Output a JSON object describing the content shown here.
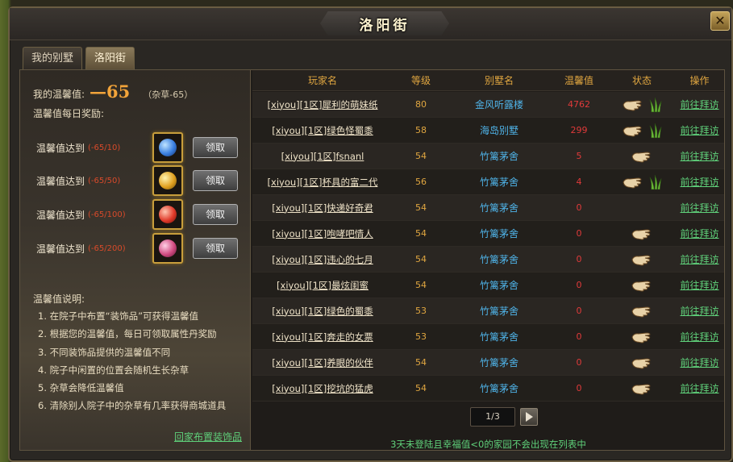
{
  "window": {
    "title": "洛阳街",
    "close_label": "✕"
  },
  "tabs": [
    {
      "label": "我的别墅",
      "active": false
    },
    {
      "label": "洛阳街",
      "active": true
    }
  ],
  "sidebar": {
    "my_warmth_label": "我的温馨值:",
    "my_warmth_value": "—65",
    "weeds_note": "（杂草-65）",
    "reward_heading": "温馨值每日奖励:",
    "rewards": [
      {
        "label": "温馨值达到",
        "condition": "(-65/10)",
        "button": "领取",
        "orb_color": "#3a7fe0"
      },
      {
        "label": "温馨值达到",
        "condition": "(-65/50)",
        "button": "领取",
        "orb_color": "#e0a020"
      },
      {
        "label": "温馨值达到",
        "condition": "(-65/100)",
        "button": "领取",
        "orb_color": "#e03a2a"
      },
      {
        "label": "温馨值达到",
        "condition": "(-65/200)",
        "button": "领取",
        "orb_color": "#d04a80"
      }
    ],
    "help_heading": "温馨值说明:",
    "help_items": [
      "1. 在院子中布置“装饰品”可获得温馨值",
      "2. 根据您的温馨值，每日可领取属性丹奖励",
      "3. 不同装饰品提供的温馨值不同",
      "4. 院子中闲置的位置会随机生长杂草",
      "5. 杂草会降低温馨值",
      "6. 清除别人院子中的杂草有几率获得商城道具"
    ],
    "decorate_link": "回家布置装饰品"
  },
  "table": {
    "headers": [
      "玩家名",
      "等级",
      "别墅名",
      "温馨值",
      "状态",
      "操作"
    ],
    "rows": [
      {
        "player": "[xiyou][1区]犀利的萌妹纸",
        "level": "80",
        "villa": "金风听露楼",
        "warmth": "4762",
        "hand": true,
        "grass": true,
        "action": "前往拜访"
      },
      {
        "player": "[xiyou][1区]绿色怪蜀黍",
        "level": "58",
        "villa": "海岛别墅",
        "warmth": "299",
        "hand": true,
        "grass": true,
        "action": "前往拜访"
      },
      {
        "player": "[xiyou][1区]fsnanl",
        "level": "54",
        "villa": "竹篱茅舍",
        "warmth": "5",
        "hand": true,
        "grass": false,
        "action": "前往拜访"
      },
      {
        "player": "[xiyou][1区]杯具的富二代",
        "level": "56",
        "villa": "竹篱茅舍",
        "warmth": "4",
        "hand": true,
        "grass": true,
        "action": "前往拜访"
      },
      {
        "player": "[xiyou][1区]快递好奇君",
        "level": "54",
        "villa": "竹篱茅舍",
        "warmth": "0",
        "hand": false,
        "grass": false,
        "action": "前往拜访"
      },
      {
        "player": "[xiyou][1区]咆哮吧情人",
        "level": "54",
        "villa": "竹篱茅舍",
        "warmth": "0",
        "hand": true,
        "grass": false,
        "action": "前往拜访"
      },
      {
        "player": "[xiyou][1区]违心的七月",
        "level": "54",
        "villa": "竹篱茅舍",
        "warmth": "0",
        "hand": true,
        "grass": false,
        "action": "前往拜访"
      },
      {
        "player": "[xiyou][1区]最炫闺蜜",
        "level": "54",
        "villa": "竹篱茅舍",
        "warmth": "0",
        "hand": true,
        "grass": false,
        "action": "前往拜访"
      },
      {
        "player": "[xiyou][1区]绿色的蜀黍",
        "level": "53",
        "villa": "竹篱茅舍",
        "warmth": "0",
        "hand": true,
        "grass": false,
        "action": "前往拜访"
      },
      {
        "player": "[xiyou][1区]奔走的女票",
        "level": "53",
        "villa": "竹篱茅舍",
        "warmth": "0",
        "hand": true,
        "grass": false,
        "action": "前往拜访"
      },
      {
        "player": "[xiyou][1区]养眼的伙伴",
        "level": "54",
        "villa": "竹篱茅舍",
        "warmth": "0",
        "hand": true,
        "grass": false,
        "action": "前往拜访"
      },
      {
        "player": "[xiyou][1区]挖坑的猛虎",
        "level": "54",
        "villa": "竹篱茅舍",
        "warmth": "0",
        "hand": true,
        "grass": false,
        "action": "前往拜访"
      }
    ]
  },
  "pagination": {
    "page_text": "1/3"
  },
  "notice": "3天未登陆且幸福值<0的家园不会出现在列表中"
}
